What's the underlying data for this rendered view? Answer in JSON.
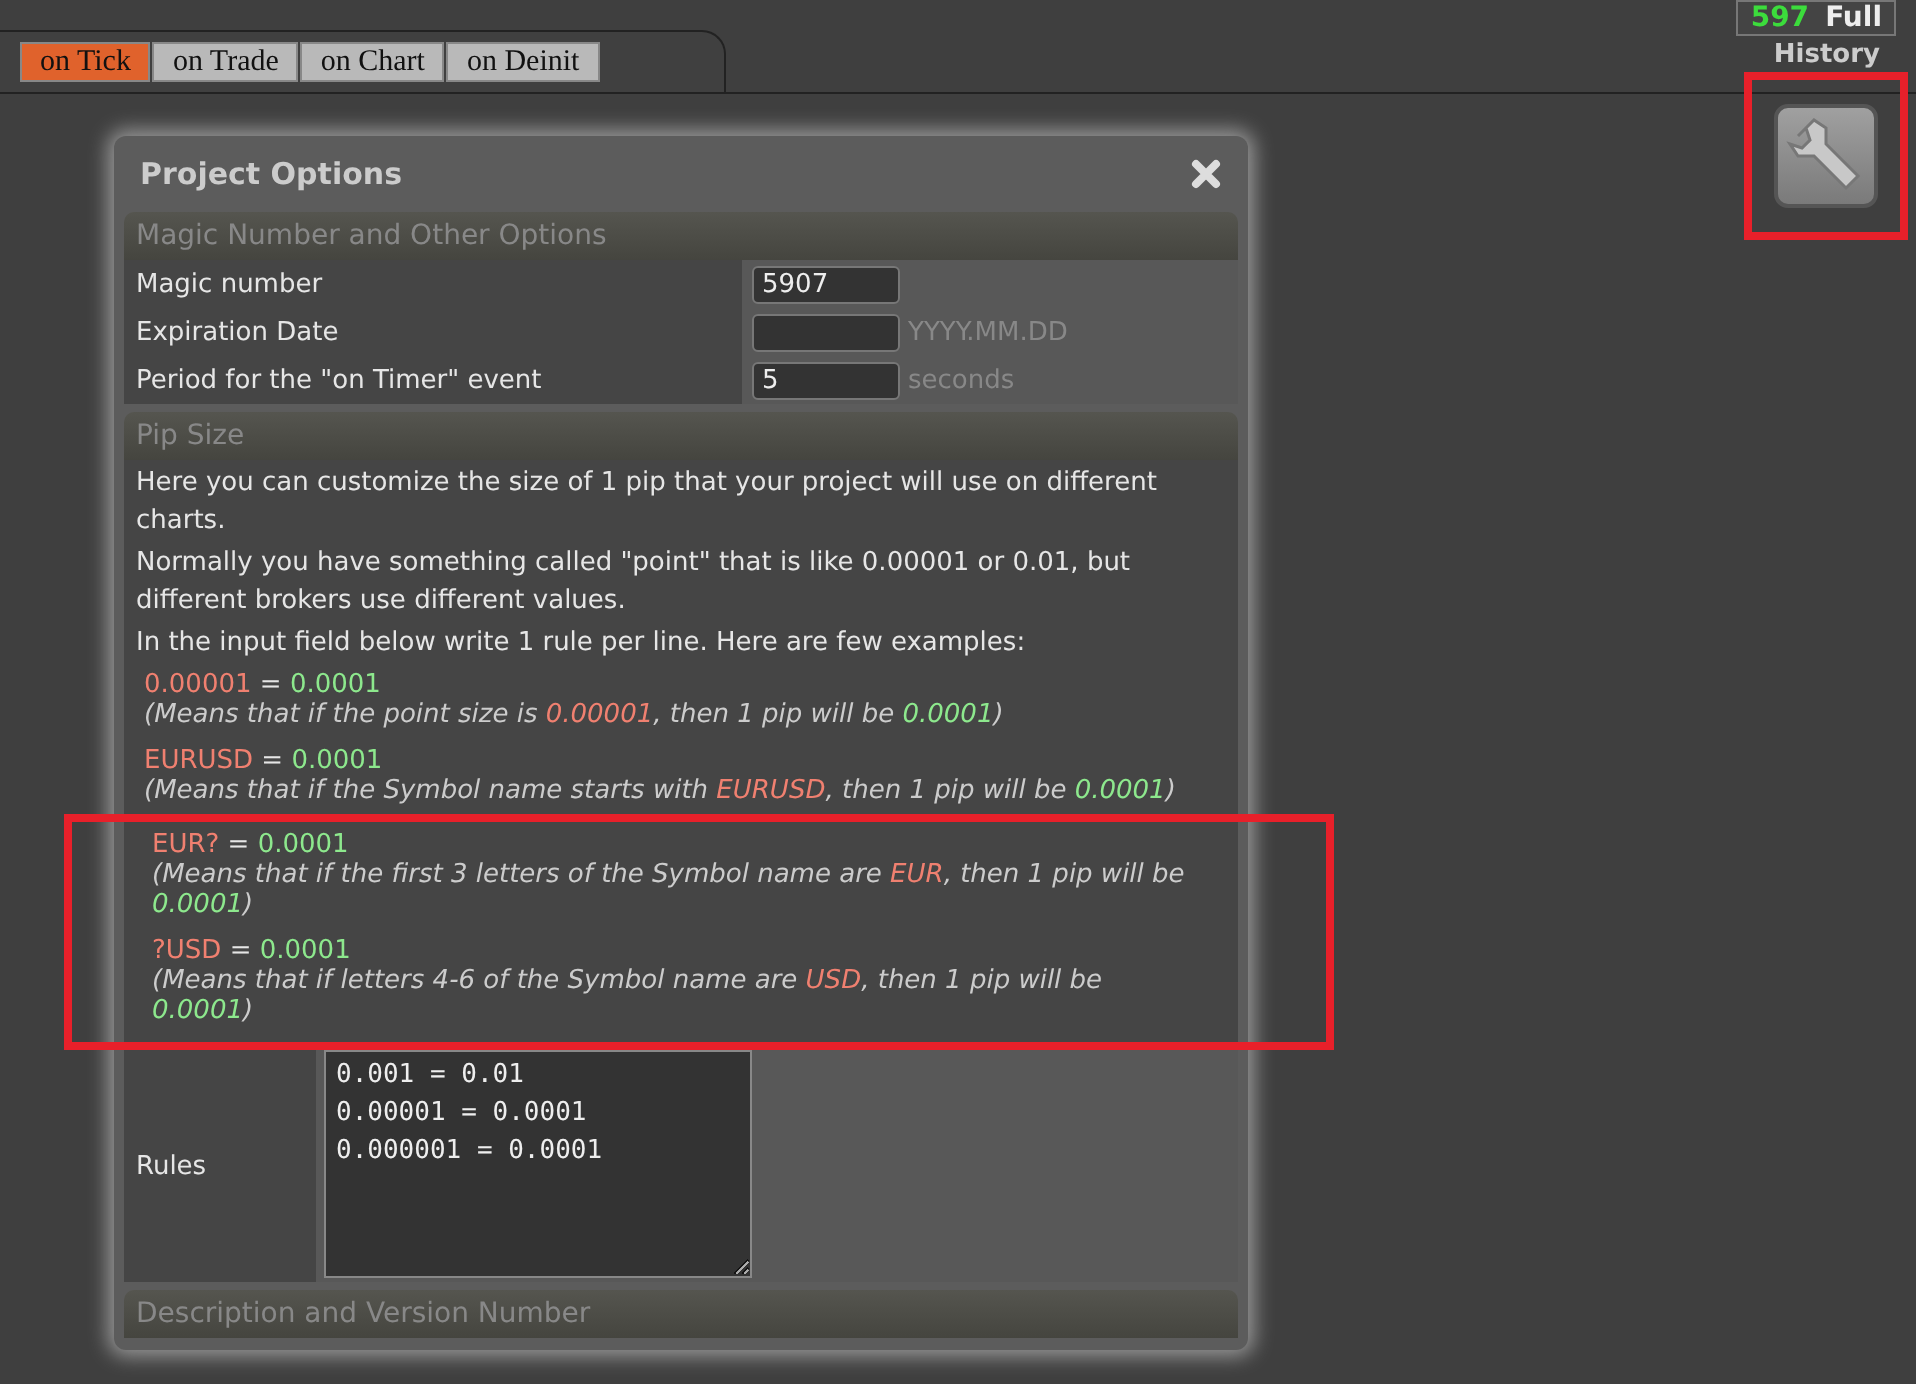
{
  "tabs": [
    {
      "label": "on Tick",
      "selected": true
    },
    {
      "label": "on Trade",
      "selected": false
    },
    {
      "label": "on Chart",
      "selected": false
    },
    {
      "label": "on Deinit",
      "selected": false
    }
  ],
  "counter": {
    "value": "597",
    "mode": "Full"
  },
  "history": {
    "label": "History",
    "highlighted": true
  },
  "dialog": {
    "title": "Project Options",
    "sections": [
      {
        "kind": "options",
        "title": "Magic Number and Other Options",
        "rows": [
          {
            "label": "Magic number",
            "value": "5907"
          },
          {
            "label": "Expiration Date",
            "placeholder": "YYYY.MM.DD"
          },
          {
            "label": "Period for the \"on Timer\" event",
            "value": "5",
            "unit": "seconds"
          }
        ]
      },
      {
        "kind": "pip",
        "title": "Pip Size",
        "paragraphs": [
          "Here you can customize the size of 1 pip that your project will use on different charts.",
          "Normally you have something called \"point\" that is like 0.00001 or 0.01, but different brokers use different values.",
          "In the input field below write 1 rule per line. Here are few examples:"
        ],
        "examples": [
          {
            "pattern": "0.00001",
            "equals": "=",
            "result": "0.0001",
            "highlighted": false,
            "note": [
              {
                "kind": "plain",
                "text": "(Means that if the point size is "
              },
              {
                "kind": "pattern",
                "text": "0.00001"
              },
              {
                "kind": "plain",
                "text": ", then 1 pip will be "
              },
              {
                "kind": "result",
                "text": "0.0001"
              },
              {
                "kind": "plain",
                "text": ")"
              }
            ]
          },
          {
            "pattern": "EURUSD",
            "equals": "=",
            "result": "0.0001",
            "highlighted": false,
            "note": [
              {
                "kind": "plain",
                "text": "(Means that if the Symbol name starts with "
              },
              {
                "kind": "pattern",
                "text": "EURUSD"
              },
              {
                "kind": "plain",
                "text": ", then 1 pip will be "
              },
              {
                "kind": "result",
                "text": "0.0001"
              },
              {
                "kind": "plain",
                "text": ")"
              }
            ]
          },
          {
            "pattern": "EUR?",
            "equals": "=",
            "result": "0.0001",
            "highlighted": true,
            "note": [
              {
                "kind": "plain",
                "text": "(Means that if the first 3 letters of the Symbol name are "
              },
              {
                "kind": "pattern",
                "text": "EUR"
              },
              {
                "kind": "plain",
                "text": ", then 1 pip will be "
              },
              {
                "kind": "result",
                "text": "0.0001"
              },
              {
                "kind": "plain",
                "text": ")"
              }
            ]
          },
          {
            "pattern": "?USD",
            "equals": "=",
            "result": "0.0001",
            "highlighted": true,
            "note": [
              {
                "kind": "plain",
                "text": "(Means that if letters 4-6 of the Symbol name are "
              },
              {
                "kind": "pattern",
                "text": "USD"
              },
              {
                "kind": "plain",
                "text": ", then 1 pip will be "
              },
              {
                "kind": "result",
                "text": "0.0001"
              },
              {
                "kind": "plain",
                "text": ")"
              }
            ]
          }
        ],
        "rules_label": "Rules",
        "rules": [
          "0.001 = 0.01",
          "0.00001 = 0.0001",
          "0.000001 = 0.0001"
        ]
      },
      {
        "kind": "collapsed",
        "title": "Description and Version Number"
      }
    ]
  }
}
